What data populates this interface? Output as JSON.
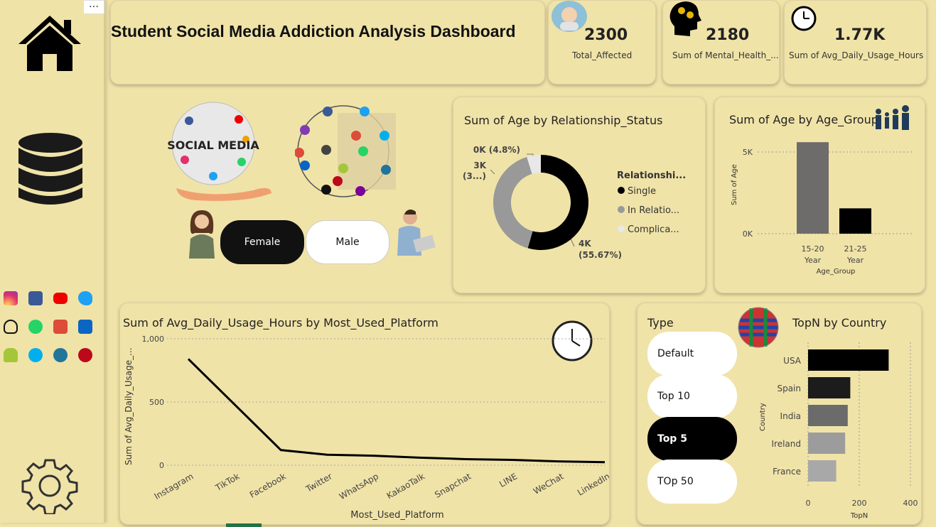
{
  "header": {
    "title": "Student Social Media Addiction Analysis Dashboard",
    "more": "…"
  },
  "kpis": [
    {
      "value": "2300",
      "label": "Total_Affected"
    },
    {
      "value": "2180",
      "label": "Sum of Mental_Health_..."
    },
    {
      "value": "1.77K",
      "label": "Sum of Avg_Daily_Usage_Hours"
    }
  ],
  "sidebar": {
    "social_icons": [
      "instagram-icon",
      "facebook-icon",
      "youtube-icon",
      "twitter-icon",
      "snapchat-icon",
      "whatsapp-icon",
      "google-plus-icon",
      "linkedin-icon",
      "android-icon",
      "skype-icon",
      "wordpress-icon",
      "pinterest-icon"
    ]
  },
  "gender": {
    "female": "Female",
    "male": "Male"
  },
  "social_graphic_text": "SOCIAL MEDIA",
  "donut": {
    "title": "Sum of Age by Relationship_Status",
    "legend_title": "Relationshi...",
    "legend": [
      "Single",
      "In Relatio...",
      "Complica..."
    ],
    "labels": [
      "4K",
      "(55.67%)",
      "3K",
      "(3...)",
      "0K (4.8%)"
    ],
    "colors": {
      "single": "#000000",
      "relationship": "#999999",
      "complicated": "#e8e8e8"
    }
  },
  "age_group": {
    "title": "Sum of Age by Age_Group"
  },
  "line_chart": {
    "title": "Sum of Avg_Daily_Usage_Hours by Most_Used_Platform"
  },
  "topn": {
    "type_label": "Type",
    "buttons": [
      "Default",
      "Top 10",
      "Top 5",
      "TOp 50"
    ],
    "selected": "Top 5",
    "title": "TopN by Country"
  },
  "chart_data": [
    {
      "type": "pie",
      "title": "Sum of Age by Relationship_Status",
      "categories": [
        "Single",
        "In Relationship",
        "Complicated"
      ],
      "values": [
        4000,
        3000,
        350
      ],
      "legend": "right"
    },
    {
      "type": "bar",
      "title": "Sum of Age by Age_Group",
      "categories": [
        "15-20 Year",
        "21-25 Year"
      ],
      "values": [
        5600,
        1550
      ],
      "xlabel": "Age_Group",
      "ylabel": "Sum of Age",
      "yticks": [
        "0K",
        "5K"
      ],
      "ylim": [
        0,
        6000
      ],
      "colors": [
        "#6e6b6b",
        "#000000"
      ]
    },
    {
      "type": "line",
      "title": "Sum of Avg_Daily_Usage_Hours by Most_Used_Platform",
      "categories": [
        "Instagram",
        "TikTok",
        "Facebook",
        "Twitter",
        "WhatsApp",
        "KakaoTalk",
        "Snapchat",
        "LINE",
        "WeChat",
        "LinkedIn"
      ],
      "values": [
        840,
        480,
        120,
        83,
        75,
        60,
        48,
        42,
        30,
        24
      ],
      "xlabel": "Most_Used_Platform",
      "ylabel": "Sum of Avg_Daily_Usage_...",
      "yticks": [
        "0",
        "500",
        "1,000"
      ],
      "ylim": [
        0,
        1000
      ]
    },
    {
      "type": "bar",
      "orientation": "horizontal",
      "title": "TopN by Country",
      "categories": [
        "USA",
        "Spain",
        "India",
        "Ireland",
        "France"
      ],
      "values": [
        315,
        165,
        155,
        145,
        110
      ],
      "xlabel": "TopN",
      "ylabel": "Country",
      "xticks": [
        "0",
        "200",
        "400"
      ],
      "xlim": [
        0,
        400
      ],
      "colors": [
        "#000000",
        "#1c1c1c",
        "#6b6b6b",
        "#9c9c9c",
        "#a8a8a8"
      ]
    }
  ]
}
